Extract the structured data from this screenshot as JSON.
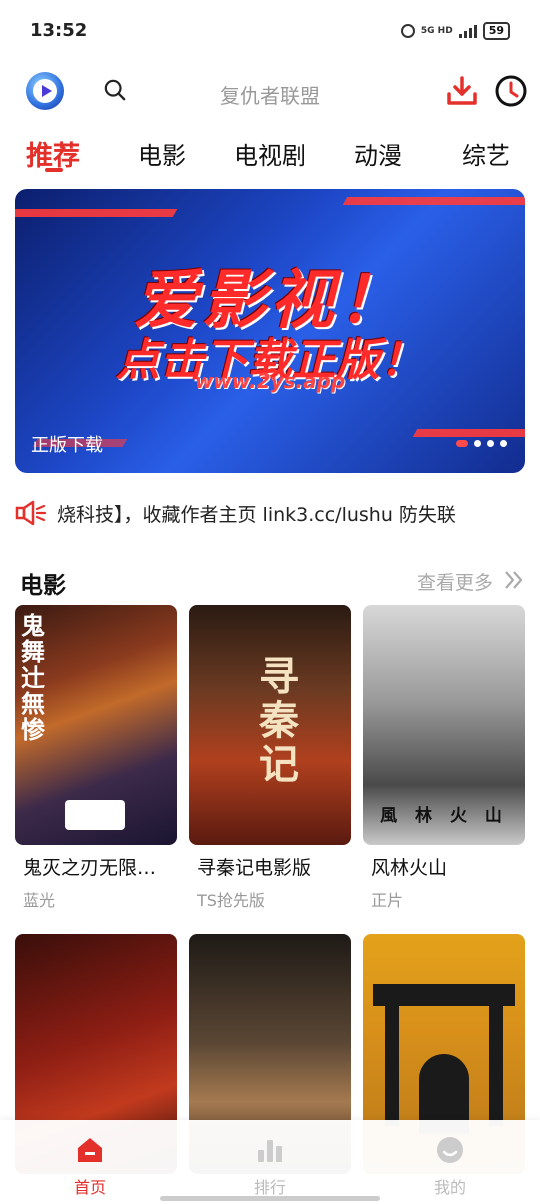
{
  "status_bar": {
    "time": "13:52",
    "network": "5G HD",
    "battery": "59"
  },
  "search": {
    "placeholder": "复仇者联盟"
  },
  "tabs": [
    {
      "label": "推荐",
      "active": true
    },
    {
      "label": "电影"
    },
    {
      "label": "电视剧"
    },
    {
      "label": "动漫"
    },
    {
      "label": "综艺"
    }
  ],
  "banner": {
    "headline": "爱影视！",
    "subheadline": "点击下载正版！",
    "url": "www.2ys.app",
    "caption": "正版下载",
    "page_count": 5,
    "active_index": 0
  },
  "notice": {
    "text": "烧科技】，收藏作者主页 link3.cc/lushu 防失联"
  },
  "section": {
    "title": "电影",
    "more": "查看更多"
  },
  "movies": [
    {
      "title": "鬼灭之刃无限…",
      "tag": "蓝光",
      "poster_text": "鬼舞辻無惨"
    },
    {
      "title": "寻秦记电影版",
      "tag": "TS抢先版",
      "poster_text": "寻秦记"
    },
    {
      "title": "风林火山",
      "tag": "正片",
      "poster_text": "風 林 火 山"
    },
    {
      "title": "",
      "tag": ""
    },
    {
      "title": "",
      "tag": ""
    },
    {
      "title": "",
      "tag": ""
    }
  ],
  "bottom_nav": [
    {
      "label": "首页",
      "icon": "home-icon",
      "active": true
    },
    {
      "label": "排行",
      "icon": "ranking-icon"
    },
    {
      "label": "我的",
      "icon": "profile-icon"
    }
  ],
  "colors": {
    "accent": "#e4302b",
    "inactive": "#bbbbbb",
    "muted": "#999999"
  }
}
